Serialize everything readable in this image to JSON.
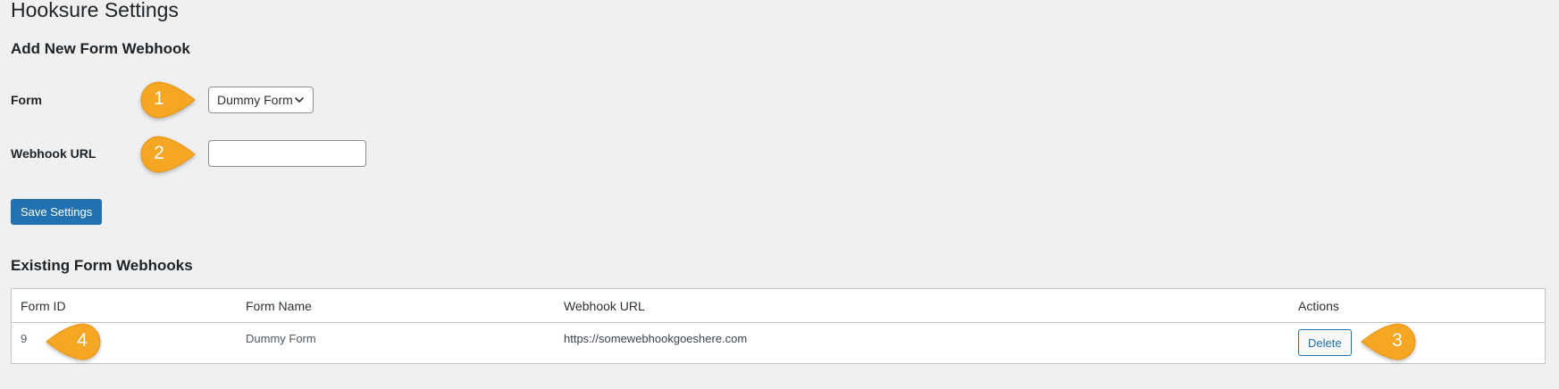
{
  "page": {
    "title": "Hooksure Settings"
  },
  "add_form": {
    "section_title": "Add New Form Webhook",
    "form_label": "Form",
    "form_select_value": "Dummy Form",
    "webhook_label": "Webhook URL",
    "webhook_value": "",
    "save_button": "Save Settings"
  },
  "existing": {
    "section_title": "Existing Form Webhooks",
    "columns": [
      "Form ID",
      "Form Name",
      "Webhook URL",
      "Actions"
    ],
    "rows": [
      {
        "form_id": "9",
        "form_name": "Dummy Form",
        "webhook_url": "https://somewebhookgoeshere.com",
        "action_label": "Delete"
      }
    ]
  },
  "callouts": [
    "1",
    "2",
    "3",
    "4"
  ],
  "colors": {
    "background": "#f0f0f1",
    "primary": "#2271b1",
    "callout": "#f5a623",
    "border": "#c3c4c7"
  },
  "icons": {
    "select_arrow": "chevron-down-icon"
  }
}
